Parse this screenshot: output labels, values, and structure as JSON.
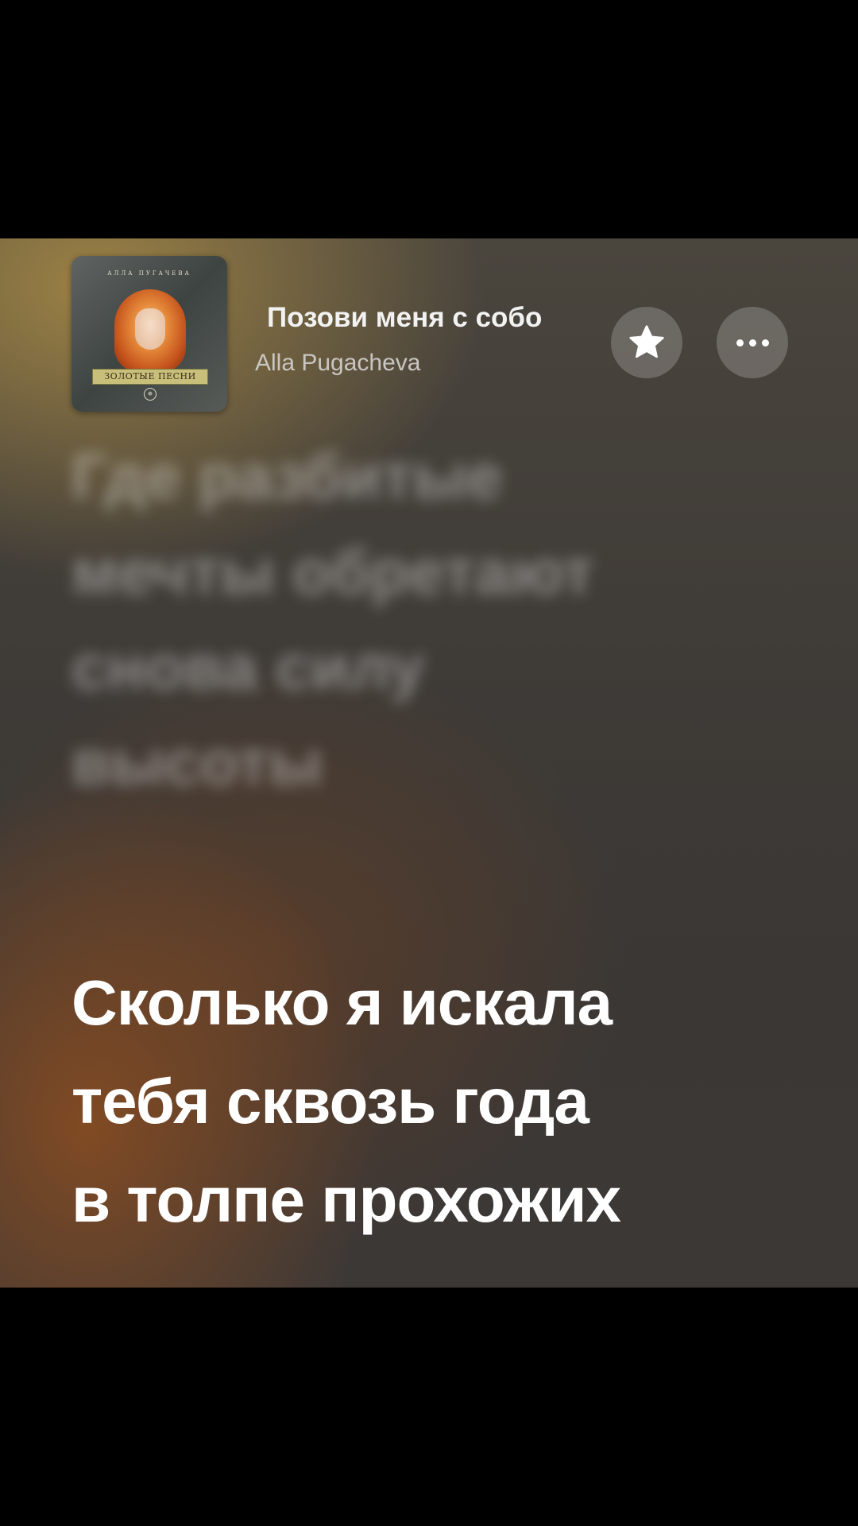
{
  "now_playing": {
    "title": "Позови меня с собо",
    "artist": "Alla Pugacheva",
    "cover": {
      "top_text": "АЛЛА ПУГАЧЕВА",
      "banner_text": "ЗОЛОТЫЕ ПЕСНИ",
      "emblem": "✵"
    }
  },
  "buttons": {
    "favorite_icon": "star-icon",
    "more_icon": "ellipsis-icon"
  },
  "lyrics": {
    "previous_lines": [
      "Где разбитые",
      "мечты обретают",
      "снова силу",
      "высоты"
    ],
    "current_lines": [
      "Сколько я искала",
      "тебя сквозь года",
      "в толпе прохожих"
    ]
  }
}
